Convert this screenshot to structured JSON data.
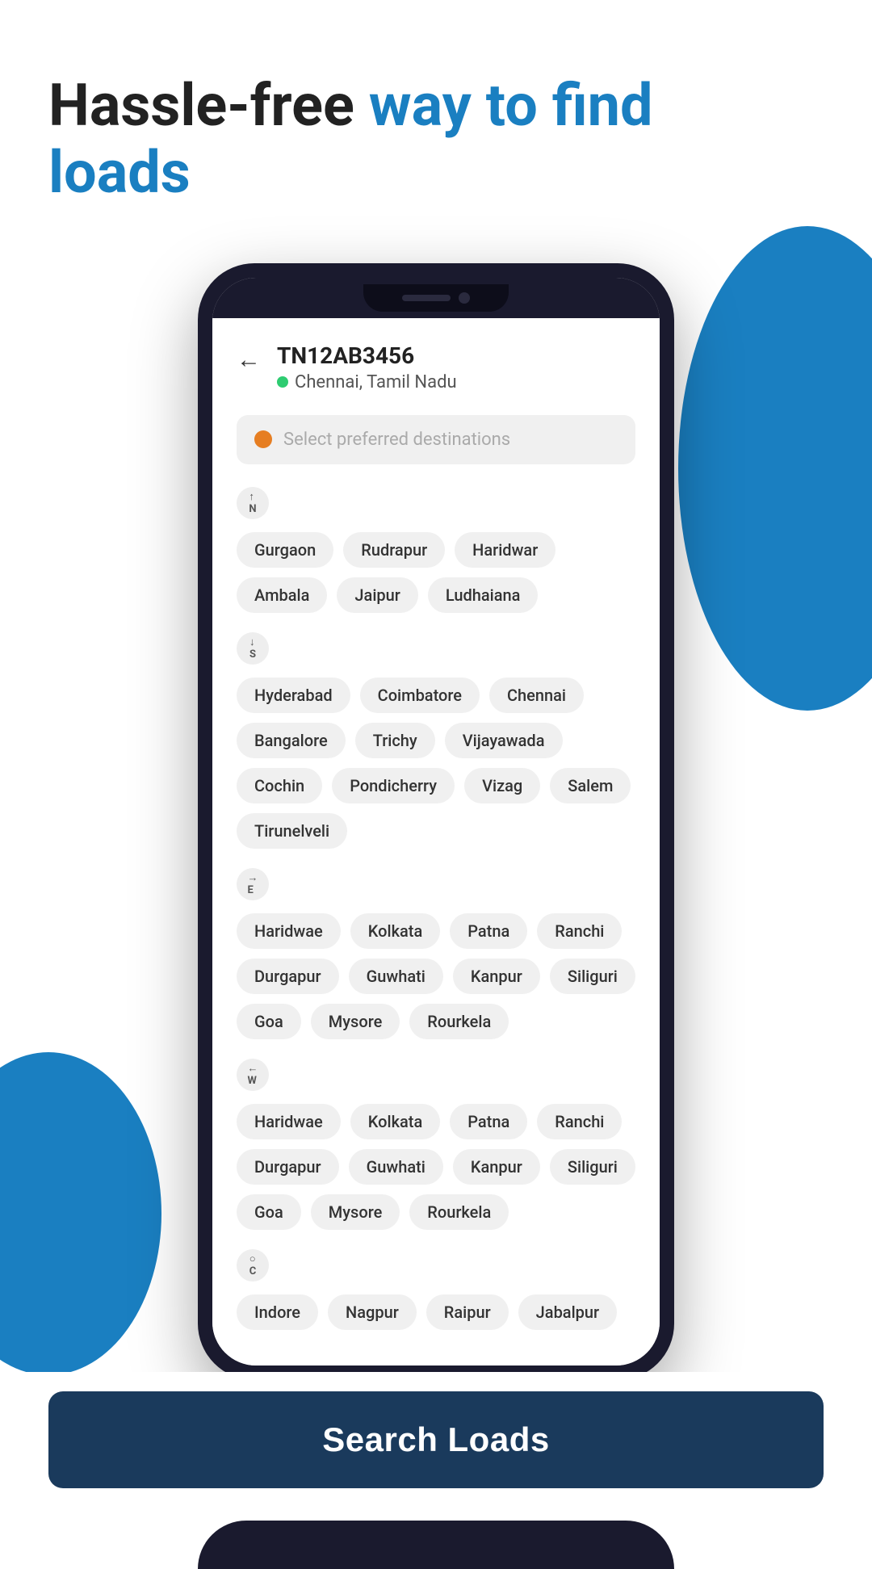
{
  "hero": {
    "title_plain": "Hassle-free ",
    "title_highlight": "way to find loads",
    "title_highlight2": "loads"
  },
  "app": {
    "vehicle_id": "TN12AB3456",
    "location": "Chennai, Tamil Nadu",
    "search_placeholder": "Select preferred destinations",
    "back_label": "←"
  },
  "directions": {
    "north": {
      "icon": "N",
      "compass": "↑\nN",
      "tags": [
        "Gurgaon",
        "Rudrapur",
        "Haridwar",
        "Ambala",
        "Jaipur",
        "Ludhaiana"
      ]
    },
    "south": {
      "icon": "S",
      "compass": "↓\nS",
      "tags": [
        "Hyderabad",
        "Coimbatore",
        "Chennai",
        "Bangalore",
        "Trichy",
        "Vijayawada",
        "Cochin",
        "Pondicherry",
        "Vizag",
        "Salem",
        "Tirunelveli"
      ]
    },
    "east": {
      "icon": "E",
      "compass": "→\nE",
      "tags": [
        "Haridwae",
        "Kolkata",
        "Patna",
        "Ranchi",
        "Durgapur",
        "Guwhati",
        "Kanpur",
        "Siliguri",
        "Goa",
        "Mysore",
        "Rourkela"
      ]
    },
    "west": {
      "icon": "W",
      "compass": "←\nW",
      "tags": [
        "Haridwae",
        "Kolkata",
        "Patna",
        "Ranchi",
        "Durgapur",
        "Guwhati",
        "Kanpur",
        "Siliguri",
        "Goa",
        "Mysore",
        "Rourkela"
      ]
    },
    "central": {
      "icon": "C",
      "compass": "○\nC",
      "tags": [
        "Indore",
        "Nagpur",
        "Raipur",
        "Jabalpur"
      ]
    }
  },
  "button": {
    "search_loads": "Search Loads"
  }
}
